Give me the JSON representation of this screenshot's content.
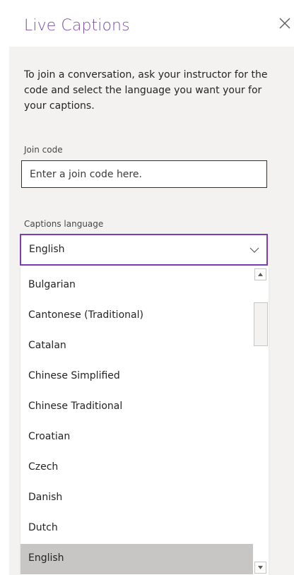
{
  "panel": {
    "title": "Live Captions",
    "description": "To join a conversation, ask your instructor for the code and select the language you want your for your captions."
  },
  "join_code": {
    "label": "Join code",
    "placeholder": "Enter a join code here.",
    "value": ""
  },
  "captions_language": {
    "label": "Captions language",
    "selected": "English",
    "options": [
      "Bulgarian",
      "Cantonese (Traditional)",
      "Catalan",
      "Chinese Simplified",
      "Chinese Traditional",
      "Croatian",
      "Czech",
      "Danish",
      "Dutch",
      "English"
    ],
    "highlighted_option": "English"
  },
  "icons": {
    "close": "close-icon",
    "chevron": "chevron-down-icon",
    "scroll_up": "scroll-up-arrow-icon",
    "scroll_down": "scroll-down-arrow-icon"
  },
  "colors": {
    "accent": "#7b4fa8",
    "select_border": "#7a3fb5",
    "panel_bg": "#f3f2f1",
    "highlight": "#c8c6c4"
  }
}
